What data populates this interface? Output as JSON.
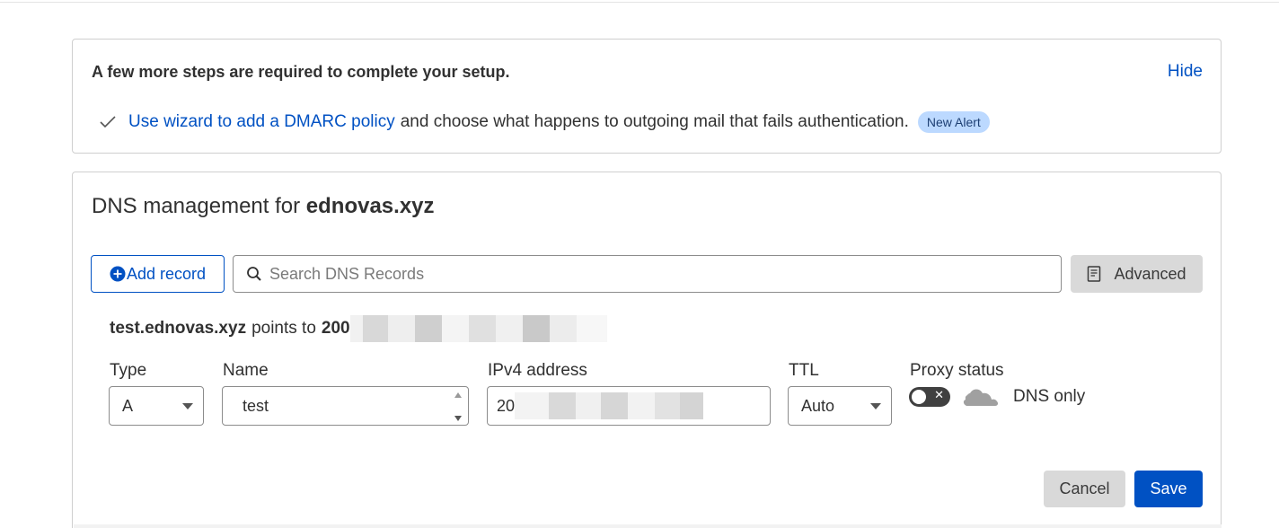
{
  "setup": {
    "title": "A few more steps are required to complete your setup.",
    "hide_label": "Hide",
    "step_link": "Use wizard to add a DMARC policy",
    "step_text": "and choose what happens to outgoing mail that fails authentication.",
    "badge": "New Alert"
  },
  "dns": {
    "title_prefix": "DNS management for",
    "domain": "ednovas.xyz",
    "add_record_label": "Add record",
    "search_placeholder": "Search DNS Records",
    "advanced_label": "Advanced",
    "points_record": "test.ednovas.xyz",
    "points_to_label": "points to",
    "points_value_visible": "200"
  },
  "form": {
    "type_label": "Type",
    "type_value": "A",
    "name_label": "Name",
    "name_value": "test",
    "ipv4_label": "IPv4 address",
    "ipv4_value_visible": "20",
    "ttl_label": "TTL",
    "ttl_value": "Auto",
    "proxy_label": "Proxy status",
    "proxy_state": "DNS only",
    "cancel_label": "Cancel",
    "save_label": "Save"
  },
  "icons": {
    "check": "check-icon",
    "plus": "plus-circle-icon",
    "search": "search-icon",
    "advanced": "book-icon",
    "cloud": "cloud-icon",
    "toggle_off": "close-icon"
  },
  "colors": {
    "accent": "#0051c3",
    "badge_bg": "#bcd9ff",
    "neutral_button": "#d9d9d9",
    "toggle_bg": "#404040"
  }
}
